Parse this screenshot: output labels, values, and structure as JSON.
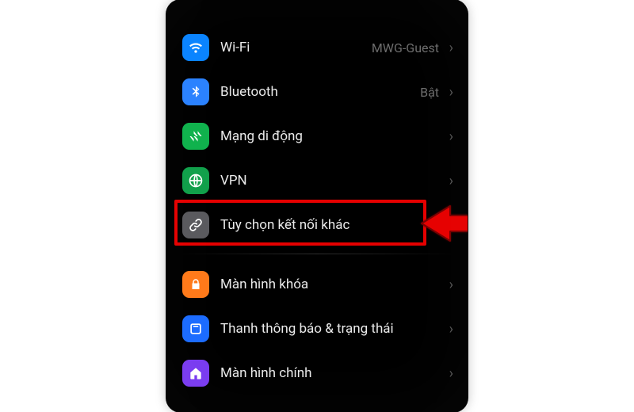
{
  "settings": {
    "items": [
      {
        "id": "wifi",
        "label": "Wi-Fi",
        "value": "MWG-Guest",
        "icon": "wifi-icon",
        "bg": "bg-blue"
      },
      {
        "id": "bluetooth",
        "label": "Bluetooth",
        "value": "Bật",
        "icon": "bluetooth-icon",
        "bg": "bg-blue2"
      },
      {
        "id": "cellular",
        "label": "Mạng di động",
        "value": "",
        "icon": "cellular-icon",
        "bg": "bg-green"
      },
      {
        "id": "vpn",
        "label": "VPN",
        "value": "",
        "icon": "vpn-icon",
        "bg": "bg-green2"
      },
      {
        "id": "more-conn",
        "label": "Tùy chọn kết nối khác",
        "value": "",
        "icon": "link-icon",
        "bg": "bg-grey"
      },
      {
        "id": "lockscreen",
        "label": "Màn hình khóa",
        "value": "",
        "icon": "lock-icon",
        "bg": "bg-orange"
      },
      {
        "id": "statusbar",
        "label": "Thanh thông báo & trạng thái",
        "value": "",
        "icon": "notification-icon",
        "bg": "bg-blue3"
      },
      {
        "id": "homescreen",
        "label": "Màn hình chính",
        "value": "",
        "icon": "home-icon",
        "bg": "bg-purple"
      }
    ],
    "divider_after_index": 4
  },
  "annotation": {
    "highlighted_item_id": "more-conn",
    "arrow_color": "#e60000"
  }
}
